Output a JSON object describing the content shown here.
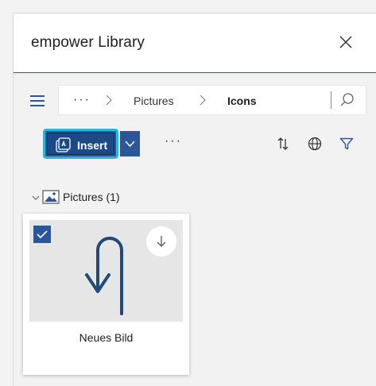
{
  "header": {
    "title": "empower Library",
    "close_icon": "close-icon"
  },
  "nav": {
    "menu_icon": "hamburger-icon",
    "breadcrumb": {
      "ellipsis": "···",
      "items": [
        "Pictures",
        "Icons"
      ]
    },
    "search_icon": "search-icon"
  },
  "toolbar": {
    "insert_label": "Insert",
    "more_label": "···",
    "icons": [
      "sort-icon",
      "globe-icon",
      "filter-icon"
    ]
  },
  "group": {
    "label": "Pictures (1)",
    "expanded": true
  },
  "items": [
    {
      "label": "Neues Bild",
      "selected": true
    }
  ],
  "colors": {
    "accent": "#2b579a",
    "focus": "#28b7d9",
    "thumb_bg": "#e6e6e6",
    "arrow": "#1f4a7a"
  }
}
